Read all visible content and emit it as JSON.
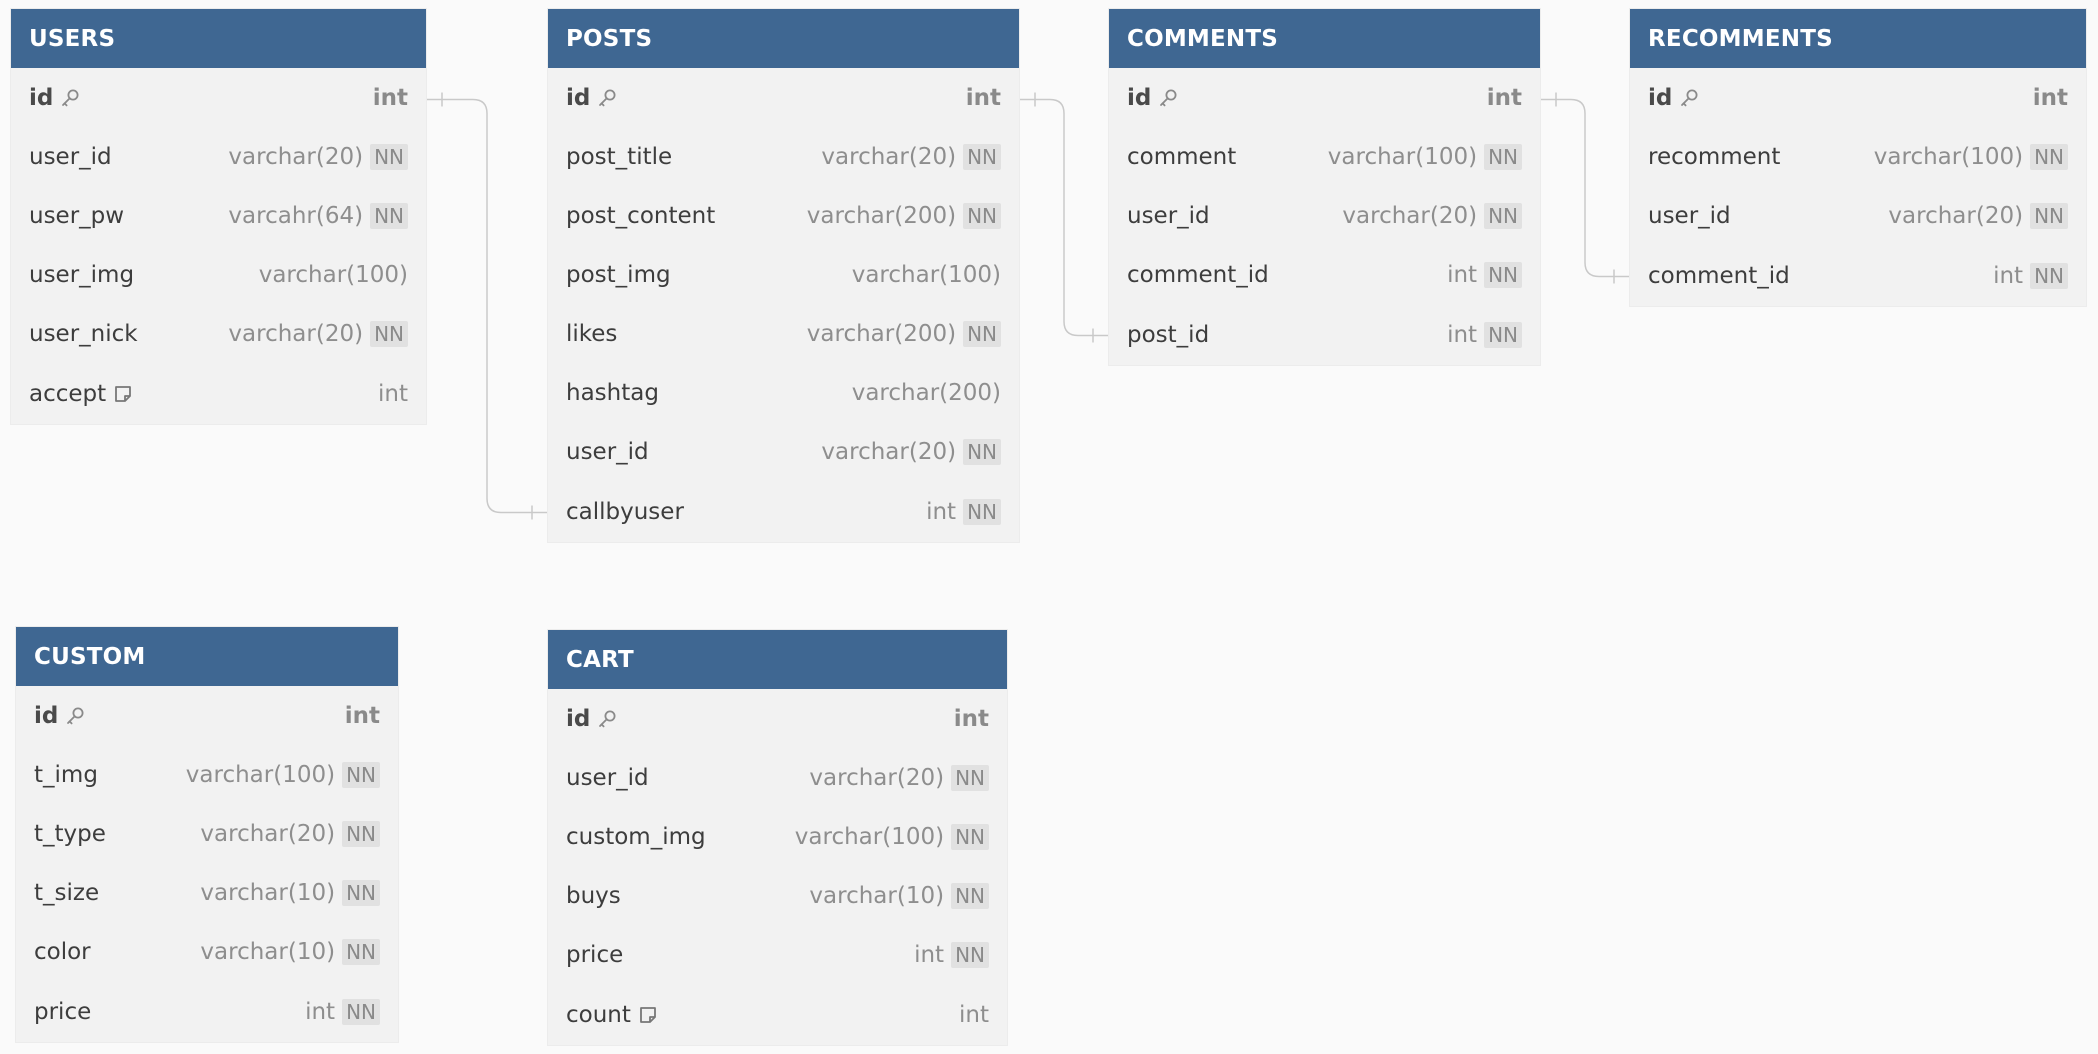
{
  "theme": {
    "header_color": "#3f6792",
    "body_color": "#f2f2f2",
    "canvas_color": "#fafafa",
    "connector_color": "#c9c9c9",
    "badge_color": "#e1e1e1"
  },
  "tables": [
    {
      "id": "users",
      "title": "USERS",
      "columns": [
        {
          "name": "id",
          "type": "int",
          "pk": true,
          "icon": "key-icon",
          "nn": false
        },
        {
          "name": "user_id",
          "type": "varchar(20)",
          "nn": true,
          "nn_label": "NN"
        },
        {
          "name": "user_pw",
          "type": "varcahr(64)",
          "nn": true,
          "nn_label": "NN"
        },
        {
          "name": "user_img",
          "type": "varchar(100)",
          "nn": false
        },
        {
          "name": "user_nick",
          "type": "varchar(20)",
          "nn": true,
          "nn_label": "NN"
        },
        {
          "name": "accept",
          "type": "int",
          "icon": "note-icon",
          "nn": false
        }
      ]
    },
    {
      "id": "posts",
      "title": "POSTS",
      "columns": [
        {
          "name": "id",
          "type": "int",
          "pk": true,
          "icon": "key-icon",
          "nn": false
        },
        {
          "name": "post_title",
          "type": "varchar(20)",
          "nn": true,
          "nn_label": "NN"
        },
        {
          "name": "post_content",
          "type": "varchar(200)",
          "nn": true,
          "nn_label": "NN"
        },
        {
          "name": "post_img",
          "type": "varchar(100)",
          "nn": false
        },
        {
          "name": "likes",
          "type": "varchar(200)",
          "nn": true,
          "nn_label": "NN"
        },
        {
          "name": "hashtag",
          "type": "varchar(200)",
          "nn": false
        },
        {
          "name": "user_id",
          "type": "varchar(20)",
          "nn": true,
          "nn_label": "NN"
        },
        {
          "name": "callbyuser",
          "type": "int",
          "nn": true,
          "nn_label": "NN"
        }
      ]
    },
    {
      "id": "comments",
      "title": "COMMENTS",
      "columns": [
        {
          "name": "id",
          "type": "int",
          "pk": true,
          "icon": "key-icon",
          "nn": false
        },
        {
          "name": "comment",
          "type": "varchar(100)",
          "nn": true,
          "nn_label": "NN"
        },
        {
          "name": "user_id",
          "type": "varchar(20)",
          "nn": true,
          "nn_label": "NN"
        },
        {
          "name": "comment_id",
          "type": "int",
          "nn": true,
          "nn_label": "NN"
        },
        {
          "name": "post_id",
          "type": "int",
          "nn": true,
          "nn_label": "NN"
        }
      ]
    },
    {
      "id": "recomments",
      "title": "RECOMMENTS",
      "columns": [
        {
          "name": "id",
          "type": "int",
          "pk": true,
          "icon": "key-icon",
          "nn": false
        },
        {
          "name": "recomment",
          "type": "varchar(100)",
          "nn": true,
          "nn_label": "NN"
        },
        {
          "name": "user_id",
          "type": "varchar(20)",
          "nn": true,
          "nn_label": "NN"
        },
        {
          "name": "comment_id",
          "type": "int",
          "nn": true,
          "nn_label": "NN"
        }
      ]
    },
    {
      "id": "custom",
      "title": "CUSTOM",
      "columns": [
        {
          "name": "id",
          "type": "int",
          "pk": true,
          "icon": "key-icon",
          "nn": false
        },
        {
          "name": "t_img",
          "type": "varchar(100)",
          "nn": true,
          "nn_label": "NN"
        },
        {
          "name": "t_type",
          "type": "varchar(20)",
          "nn": true,
          "nn_label": "NN"
        },
        {
          "name": "t_size",
          "type": "varchar(10)",
          "nn": true,
          "nn_label": "NN"
        },
        {
          "name": "color",
          "type": "varchar(10)",
          "nn": true,
          "nn_label": "NN"
        },
        {
          "name": "price",
          "type": "int",
          "nn": true,
          "nn_label": "NN"
        }
      ]
    },
    {
      "id": "cart",
      "title": "CART",
      "columns": [
        {
          "name": "id",
          "type": "int",
          "pk": true,
          "icon": "key-icon",
          "nn": false
        },
        {
          "name": "user_id",
          "type": "varchar(20)",
          "nn": true,
          "nn_label": "NN"
        },
        {
          "name": "custom_img",
          "type": "varchar(100)",
          "nn": true,
          "nn_label": "NN"
        },
        {
          "name": "buys",
          "type": "varchar(10)",
          "nn": true,
          "nn_label": "NN"
        },
        {
          "name": "price",
          "type": "int",
          "nn": true,
          "nn_label": "NN"
        },
        {
          "name": "count",
          "type": "int",
          "icon": "note-icon",
          "nn": false
        }
      ]
    }
  ],
  "relationships": [
    {
      "from_table": "users",
      "from_column": "id",
      "to_table": "posts",
      "to_column": "callbyuser"
    },
    {
      "from_table": "posts",
      "from_column": "id",
      "to_table": "comments",
      "to_column": "post_id"
    },
    {
      "from_table": "comments",
      "from_column": "id",
      "to_table": "recomments",
      "to_column": "comment_id"
    }
  ]
}
